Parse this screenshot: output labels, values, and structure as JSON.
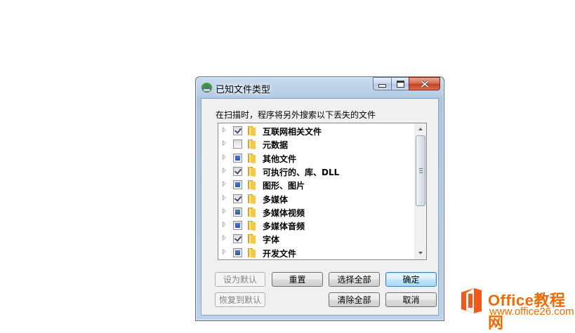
{
  "window": {
    "title": "已知文件类型",
    "icon": "app-icon",
    "caption_buttons": [
      "minimize-icon",
      "maximize-icon",
      "close-icon"
    ]
  },
  "instruction": "在扫描时，程序将另外搜索以下丢失的文件",
  "file_types": [
    {
      "label": "互联网相关文件",
      "state": "checked"
    },
    {
      "label": "元数据",
      "state": "unchecked"
    },
    {
      "label": "其他文件",
      "state": "partial"
    },
    {
      "label": "可执行的、库、DLL",
      "state": "checked"
    },
    {
      "label": "图形、图片",
      "state": "partial"
    },
    {
      "label": "多媒体",
      "state": "checked"
    },
    {
      "label": "多媒体视频",
      "state": "partial"
    },
    {
      "label": "多媒体音频",
      "state": "partial"
    },
    {
      "label": "字体",
      "state": "checked"
    },
    {
      "label": "开发文件",
      "state": "partial"
    }
  ],
  "buttons": {
    "set_default": "设为默认",
    "reset": "重置",
    "select_all": "选择全部",
    "ok": "确定",
    "restore_default": "恢复到默认",
    "clear_all": "清除全部",
    "cancel": "取消"
  },
  "watermark": {
    "title": "Office教程网",
    "url": "www.office26.com"
  },
  "colors": {
    "watermark_orange": "#ef6a00",
    "checkbox_fill": "#2c5aa3",
    "folder_yellow": "#f2c94c"
  }
}
